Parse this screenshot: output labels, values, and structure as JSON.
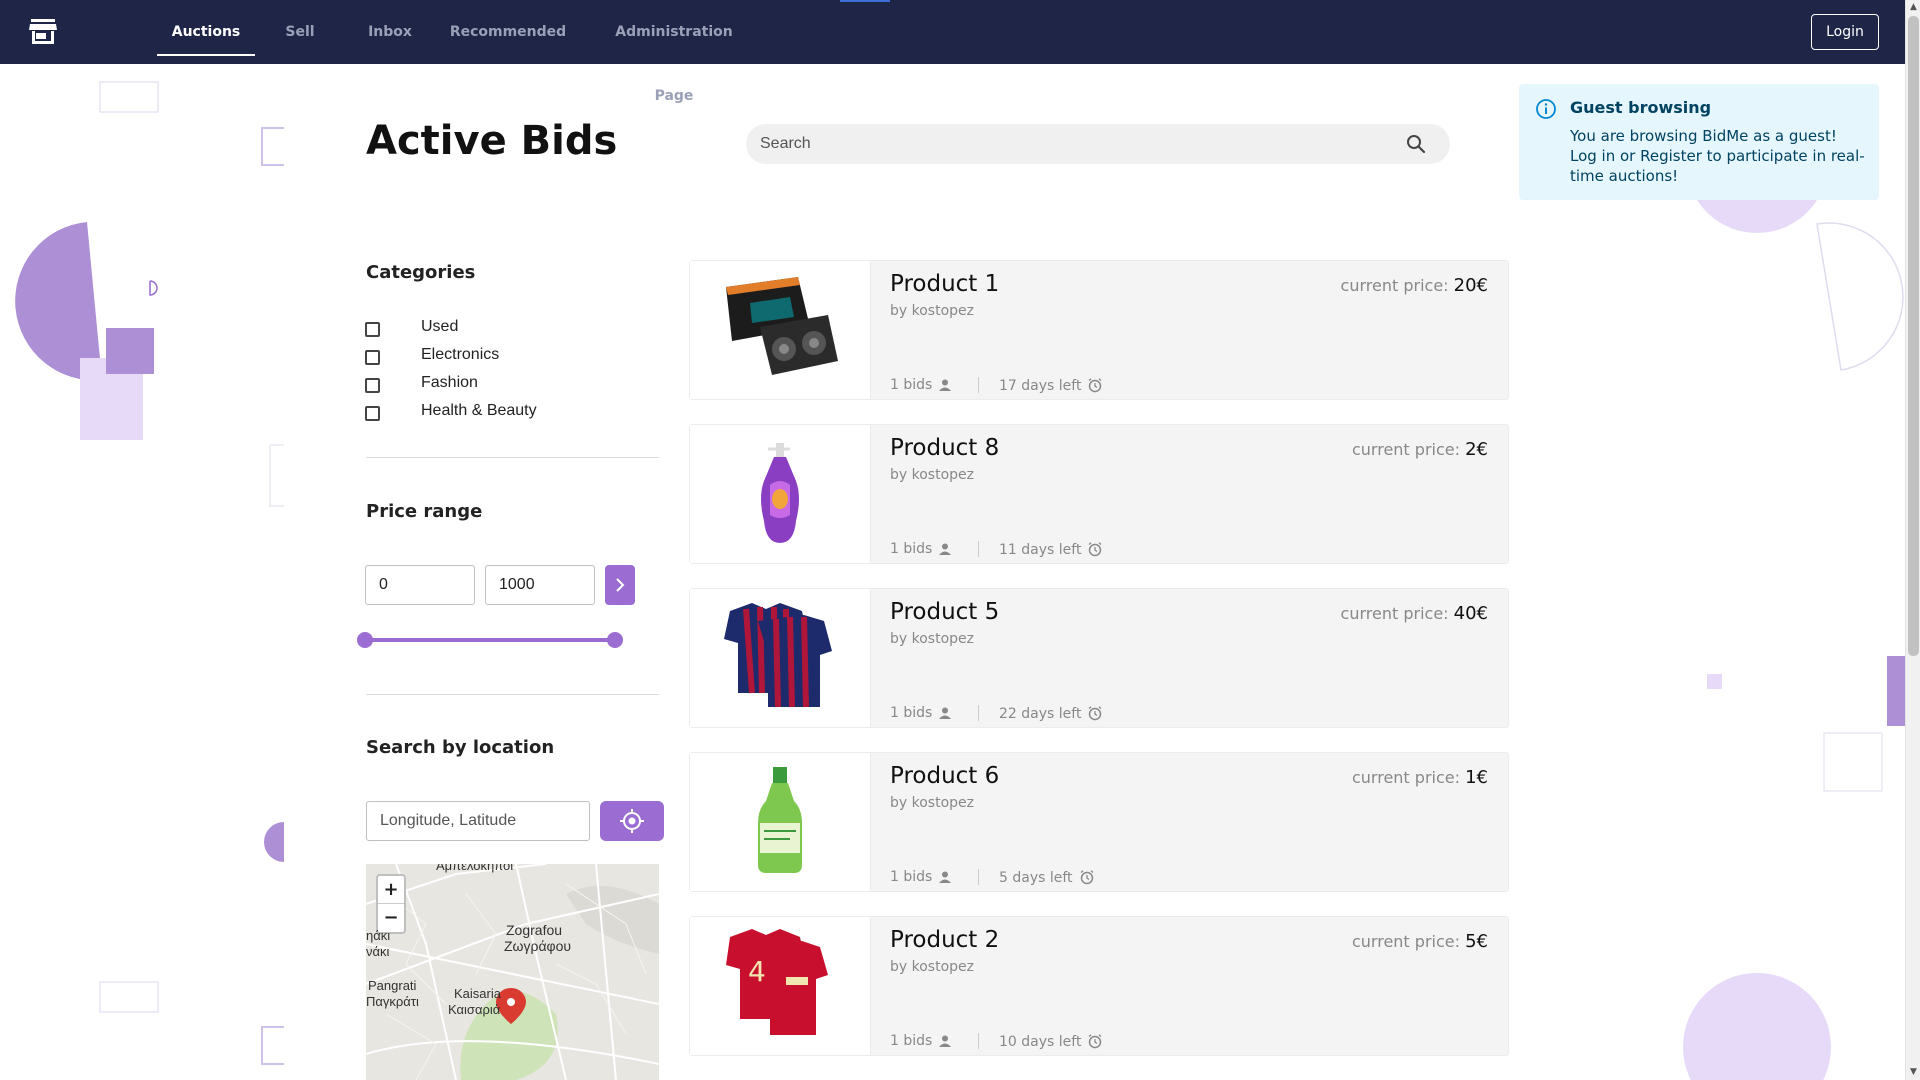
{
  "nav": {
    "items": [
      {
        "label": "Auctions",
        "active": true
      },
      {
        "label": "Sell"
      },
      {
        "label": "Inbox"
      },
      {
        "label": "Recommended"
      },
      {
        "label": "Administration Page"
      }
    ],
    "login_label": "Login",
    "logo_icon": "storefront-icon"
  },
  "page": {
    "title": "Active Bids",
    "search_placeholder": "Search"
  },
  "alert": {
    "title": "Guest browsing",
    "text": "You are browsing BidMe as a guest! Log in or Register to participate in real-time auctions!",
    "icon": "info-icon"
  },
  "filters": {
    "categories_heading": "Categories",
    "categories": [
      {
        "label": "Used",
        "checked": false
      },
      {
        "label": "Electronics",
        "checked": false
      },
      {
        "label": "Fashion",
        "checked": false
      },
      {
        "label": "Health & Beauty",
        "checked": false
      }
    ],
    "price_heading": "Price range",
    "price_min": "0",
    "price_max": "1000",
    "price_slider": [
      0,
      1
    ],
    "location_heading": "Search by location",
    "location_placeholder": "Longitude, Latitude",
    "map": {
      "zoom_in": "+",
      "zoom_out": "−",
      "labels": {
        "top": "Αμπελόκηποι",
        "zografou_en": "Zografou",
        "zografou_gr": "Ζωγράφου",
        "left1": "ηάκι",
        "left2": "νάκι",
        "pangrati_en": "Pangrati",
        "pangrati_gr": "Παγκράτι",
        "kaisaria_en": "Kaisaria",
        "kaisaria_gr": "Καισαριά"
      }
    }
  },
  "products": [
    {
      "name": "Product 1",
      "seller": "by kostopez",
      "price_label": "current price:",
      "price": "20€",
      "bids": "1 bids",
      "days_left": "17 days left",
      "image": "graphics-card"
    },
    {
      "name": "Product 8",
      "seller": "by kostopez",
      "price_label": "current price:",
      "price": "2€",
      "bids": "1 bids",
      "days_left": "11 days left",
      "image": "soap-bottle"
    },
    {
      "name": "Product 5",
      "seller": "by kostopez",
      "price_label": "current price:",
      "price": "40€",
      "bids": "1 bids",
      "days_left": "22 days left",
      "image": "barcelona-jersey"
    },
    {
      "name": "Product 6",
      "seller": "by kostopez",
      "price_label": "current price:",
      "price": "1€",
      "bids": "1 bids",
      "days_left": "5 days left",
      "image": "green-bottle"
    },
    {
      "name": "Product 2",
      "seller": "by kostopez",
      "price_label": "current price:",
      "price": "5€",
      "bids": "1 bids",
      "days_left": "10 days left",
      "image": "liverpool-jersey"
    }
  ],
  "colors": {
    "nav_bg": "#1f2547",
    "accent_purple": "#9b6cd1",
    "alert_bg": "#e5f6fd",
    "alert_text": "#014361"
  }
}
